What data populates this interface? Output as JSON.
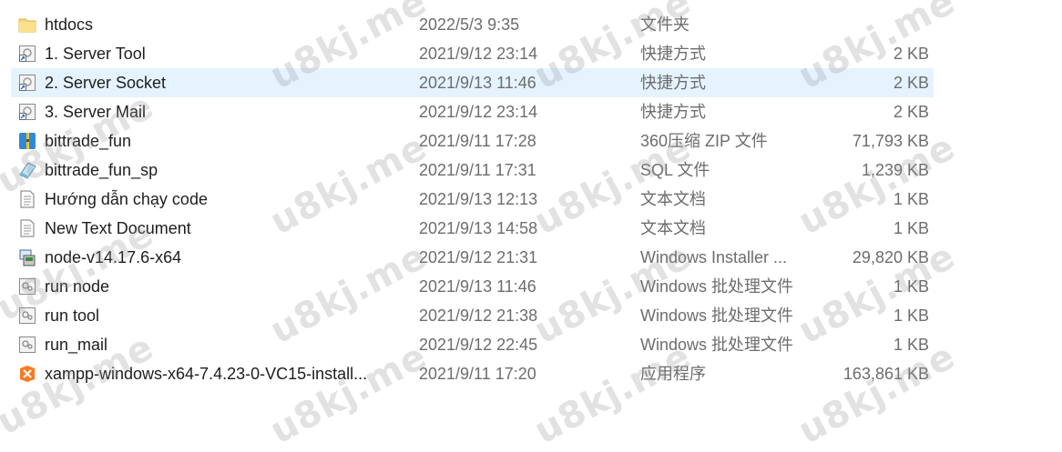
{
  "files": [
    {
      "name": "htdocs",
      "date": "2022/5/3 9:35",
      "type": "文件夹",
      "size": "",
      "icon": "folder-icon"
    },
    {
      "name": "1. Server Tool",
      "date": "2021/9/12 23:14",
      "type": "快捷方式",
      "size": "2 KB",
      "icon": "shortcut-icon"
    },
    {
      "name": "2. Server Socket",
      "date": "2021/9/13 11:46",
      "type": "快捷方式",
      "size": "2 KB",
      "icon": "shortcut-icon",
      "selected": true
    },
    {
      "name": "3. Server Mail",
      "date": "2021/9/12 23:14",
      "type": "快捷方式",
      "size": "2 KB",
      "icon": "shortcut-icon"
    },
    {
      "name": "bittrade_fun",
      "date": "2021/9/11 17:28",
      "type": "360压缩 ZIP 文件",
      "size": "71,793 KB",
      "icon": "zip-archive-icon"
    },
    {
      "name": "bittrade_fun_sp",
      "date": "2021/9/11 17:31",
      "type": "SQL 文件",
      "size": "1,239 KB",
      "icon": "sql-file-icon"
    },
    {
      "name": "Hướng dẫn chạy code",
      "date": "2021/9/13 12:13",
      "type": "文本文档",
      "size": "1 KB",
      "icon": "text-document-icon"
    },
    {
      "name": "New Text Document",
      "date": "2021/9/13 14:58",
      "type": "文本文档",
      "size": "1 KB",
      "icon": "text-document-icon"
    },
    {
      "name": "node-v14.17.6-x64",
      "date": "2021/9/12 21:31",
      "type": "Windows Installer ...",
      "size": "29,820 KB",
      "icon": "installer-icon"
    },
    {
      "name": "run node",
      "date": "2021/9/13 11:46",
      "type": "Windows 批处理文件",
      "size": "1 KB",
      "icon": "batch-file-icon"
    },
    {
      "name": "run tool",
      "date": "2021/9/12 21:38",
      "type": "Windows 批处理文件",
      "size": "1 KB",
      "icon": "batch-file-icon"
    },
    {
      "name": "run_mail",
      "date": "2021/9/12 22:45",
      "type": "Windows 批处理文件",
      "size": "1 KB",
      "icon": "batch-file-icon"
    },
    {
      "name": "xampp-windows-x64-7.4.23-0-VC15-install...",
      "date": "2021/9/11 17:20",
      "type": "应用程序",
      "size": "163,861 KB",
      "icon": "application-icon"
    }
  ],
  "watermark": "u8kj.me",
  "colors": {
    "selection": "#e5f3ff",
    "text": "#1e1e1e",
    "secondary_text": "#6d6d6d",
    "folder": "#f8d775"
  }
}
